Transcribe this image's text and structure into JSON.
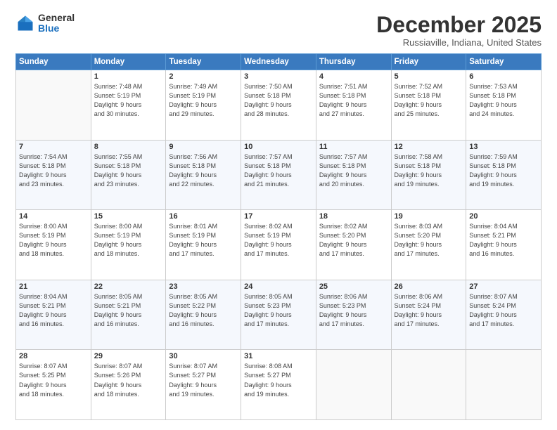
{
  "logo": {
    "general": "General",
    "blue": "Blue"
  },
  "header": {
    "month": "December 2025",
    "location": "Russiaville, Indiana, United States"
  },
  "days_of_week": [
    "Sunday",
    "Monday",
    "Tuesday",
    "Wednesday",
    "Thursday",
    "Friday",
    "Saturday"
  ],
  "weeks": [
    [
      {
        "day": "",
        "info": ""
      },
      {
        "day": "1",
        "info": "Sunrise: 7:48 AM\nSunset: 5:19 PM\nDaylight: 9 hours\nand 30 minutes."
      },
      {
        "day": "2",
        "info": "Sunrise: 7:49 AM\nSunset: 5:19 PM\nDaylight: 9 hours\nand 29 minutes."
      },
      {
        "day": "3",
        "info": "Sunrise: 7:50 AM\nSunset: 5:18 PM\nDaylight: 9 hours\nand 28 minutes."
      },
      {
        "day": "4",
        "info": "Sunrise: 7:51 AM\nSunset: 5:18 PM\nDaylight: 9 hours\nand 27 minutes."
      },
      {
        "day": "5",
        "info": "Sunrise: 7:52 AM\nSunset: 5:18 PM\nDaylight: 9 hours\nand 25 minutes."
      },
      {
        "day": "6",
        "info": "Sunrise: 7:53 AM\nSunset: 5:18 PM\nDaylight: 9 hours\nand 24 minutes."
      }
    ],
    [
      {
        "day": "7",
        "info": "Sunrise: 7:54 AM\nSunset: 5:18 PM\nDaylight: 9 hours\nand 23 minutes."
      },
      {
        "day": "8",
        "info": "Sunrise: 7:55 AM\nSunset: 5:18 PM\nDaylight: 9 hours\nand 23 minutes."
      },
      {
        "day": "9",
        "info": "Sunrise: 7:56 AM\nSunset: 5:18 PM\nDaylight: 9 hours\nand 22 minutes."
      },
      {
        "day": "10",
        "info": "Sunrise: 7:57 AM\nSunset: 5:18 PM\nDaylight: 9 hours\nand 21 minutes."
      },
      {
        "day": "11",
        "info": "Sunrise: 7:57 AM\nSunset: 5:18 PM\nDaylight: 9 hours\nand 20 minutes."
      },
      {
        "day": "12",
        "info": "Sunrise: 7:58 AM\nSunset: 5:18 PM\nDaylight: 9 hours\nand 19 minutes."
      },
      {
        "day": "13",
        "info": "Sunrise: 7:59 AM\nSunset: 5:18 PM\nDaylight: 9 hours\nand 19 minutes."
      }
    ],
    [
      {
        "day": "14",
        "info": "Sunrise: 8:00 AM\nSunset: 5:19 PM\nDaylight: 9 hours\nand 18 minutes."
      },
      {
        "day": "15",
        "info": "Sunrise: 8:00 AM\nSunset: 5:19 PM\nDaylight: 9 hours\nand 18 minutes."
      },
      {
        "day": "16",
        "info": "Sunrise: 8:01 AM\nSunset: 5:19 PM\nDaylight: 9 hours\nand 17 minutes."
      },
      {
        "day": "17",
        "info": "Sunrise: 8:02 AM\nSunset: 5:19 PM\nDaylight: 9 hours\nand 17 minutes."
      },
      {
        "day": "18",
        "info": "Sunrise: 8:02 AM\nSunset: 5:20 PM\nDaylight: 9 hours\nand 17 minutes."
      },
      {
        "day": "19",
        "info": "Sunrise: 8:03 AM\nSunset: 5:20 PM\nDaylight: 9 hours\nand 17 minutes."
      },
      {
        "day": "20",
        "info": "Sunrise: 8:04 AM\nSunset: 5:21 PM\nDaylight: 9 hours\nand 16 minutes."
      }
    ],
    [
      {
        "day": "21",
        "info": "Sunrise: 8:04 AM\nSunset: 5:21 PM\nDaylight: 9 hours\nand 16 minutes."
      },
      {
        "day": "22",
        "info": "Sunrise: 8:05 AM\nSunset: 5:21 PM\nDaylight: 9 hours\nand 16 minutes."
      },
      {
        "day": "23",
        "info": "Sunrise: 8:05 AM\nSunset: 5:22 PM\nDaylight: 9 hours\nand 16 minutes."
      },
      {
        "day": "24",
        "info": "Sunrise: 8:05 AM\nSunset: 5:23 PM\nDaylight: 9 hours\nand 17 minutes."
      },
      {
        "day": "25",
        "info": "Sunrise: 8:06 AM\nSunset: 5:23 PM\nDaylight: 9 hours\nand 17 minutes."
      },
      {
        "day": "26",
        "info": "Sunrise: 8:06 AM\nSunset: 5:24 PM\nDaylight: 9 hours\nand 17 minutes."
      },
      {
        "day": "27",
        "info": "Sunrise: 8:07 AM\nSunset: 5:24 PM\nDaylight: 9 hours\nand 17 minutes."
      }
    ],
    [
      {
        "day": "28",
        "info": "Sunrise: 8:07 AM\nSunset: 5:25 PM\nDaylight: 9 hours\nand 18 minutes."
      },
      {
        "day": "29",
        "info": "Sunrise: 8:07 AM\nSunset: 5:26 PM\nDaylight: 9 hours\nand 18 minutes."
      },
      {
        "day": "30",
        "info": "Sunrise: 8:07 AM\nSunset: 5:27 PM\nDaylight: 9 hours\nand 19 minutes."
      },
      {
        "day": "31",
        "info": "Sunrise: 8:08 AM\nSunset: 5:27 PM\nDaylight: 9 hours\nand 19 minutes."
      },
      {
        "day": "",
        "info": ""
      },
      {
        "day": "",
        "info": ""
      },
      {
        "day": "",
        "info": ""
      }
    ]
  ]
}
